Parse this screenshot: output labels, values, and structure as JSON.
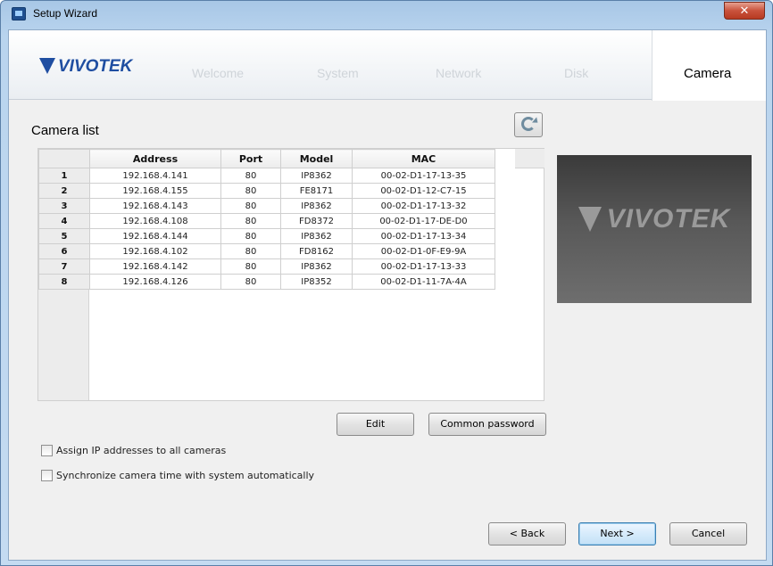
{
  "window": {
    "title": "Setup Wizard",
    "close_label": "✕"
  },
  "header": {
    "logo_text": "VIVOTEK",
    "steps": [
      {
        "label": "Welcome",
        "active": false
      },
      {
        "label": "System",
        "active": false
      },
      {
        "label": "Network",
        "active": false
      },
      {
        "label": "Disk",
        "active": false
      },
      {
        "label": "Camera",
        "active": true
      }
    ]
  },
  "camera_list": {
    "label": "Camera list",
    "columns": [
      "Address",
      "Port",
      "Model",
      "MAC"
    ],
    "rows": [
      {
        "index": "1",
        "address": "192.168.4.141",
        "port": "80",
        "model": "IP8362",
        "mac": "00-02-D1-17-13-35"
      },
      {
        "index": "2",
        "address": "192.168.4.155",
        "port": "80",
        "model": "FE8171",
        "mac": "00-02-D1-12-C7-15"
      },
      {
        "index": "3",
        "address": "192.168.4.143",
        "port": "80",
        "model": "IP8362",
        "mac": "00-02-D1-17-13-32"
      },
      {
        "index": "4",
        "address": "192.168.4.108",
        "port": "80",
        "model": "FD8372",
        "mac": "00-02-D1-17-DE-D0"
      },
      {
        "index": "5",
        "address": "192.168.4.144",
        "port": "80",
        "model": "IP8362",
        "mac": "00-02-D1-17-13-34"
      },
      {
        "index": "6",
        "address": "192.168.4.102",
        "port": "80",
        "model": "FD8162",
        "mac": "00-02-D1-0F-E9-9A"
      },
      {
        "index": "7",
        "address": "192.168.4.142",
        "port": "80",
        "model": "IP8362",
        "mac": "00-02-D1-17-13-33"
      },
      {
        "index": "8",
        "address": "192.168.4.126",
        "port": "80",
        "model": "IP8352",
        "mac": "00-02-D1-11-7A-4A"
      }
    ]
  },
  "preview": {
    "logo_text": "VIVOTEK"
  },
  "buttons": {
    "edit": "Edit",
    "common_password": "Common password",
    "back": "< Back",
    "next": "Next >",
    "cancel": "Cancel"
  },
  "options": {
    "assign_ip": {
      "label": "Assign IP addresses to all cameras",
      "checked": false
    },
    "sync_time": {
      "label": "Synchronize camera time with system automatically",
      "checked": false
    }
  }
}
